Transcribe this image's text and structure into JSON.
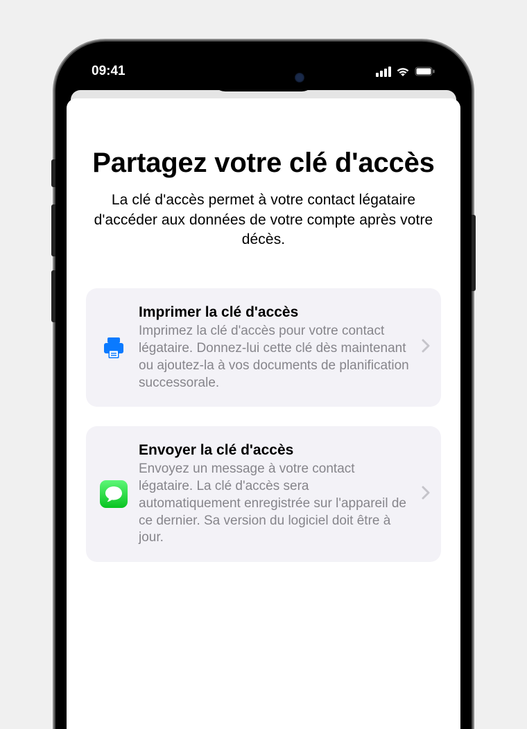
{
  "status": {
    "time": "09:41"
  },
  "title": "Partagez votre clé d'accès",
  "subtitle": "La clé d'accès permet à votre contact légataire d'accéder aux données de votre compte après votre décès.",
  "options": {
    "print": {
      "title": "Imprimer la clé d'accès",
      "desc": "Imprimez la clé d'accès pour votre contact légataire. Donnez-lui cette clé dès maintenant ou ajoutez-la à vos documents de planification successorale."
    },
    "send": {
      "title": "Envoyer la clé d'accès",
      "desc": "Envoyez un message à votre contact légataire. La clé d'accès sera automatiquement enregistrée sur l'appareil de ce dernier. Sa version du logiciel doit être à jour."
    }
  }
}
